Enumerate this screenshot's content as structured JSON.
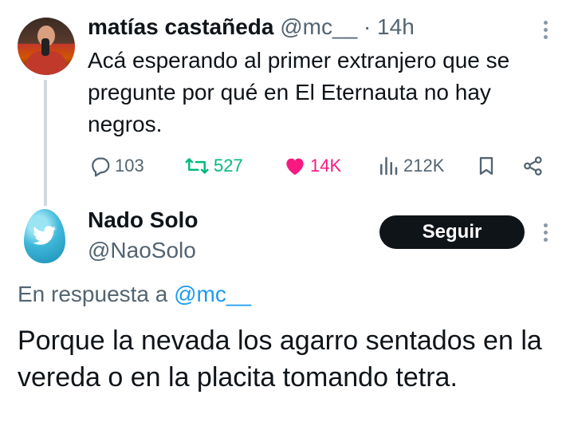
{
  "tweet1": {
    "author_name": "matías castañeda",
    "author_handle": "@mc__",
    "separator": "·",
    "time": "14h",
    "text": "Acá esperando al primer extranjero que se pregunte por qué en El Eternauta no hay negros.",
    "stats": {
      "replies": "103",
      "retweets": "527",
      "likes": "14K",
      "views": "212K"
    },
    "liked": true,
    "colors": {
      "retweet": "#00ba7c",
      "like": "#f91880",
      "muted": "#536471"
    }
  },
  "tweet2": {
    "author_name": "Nado Solo",
    "author_handle": "@NaoSolo",
    "follow_label": "Seguir",
    "reply_prefix": "En respuesta a",
    "reply_to_handle": "@mc__",
    "text": "Porque la nevada los agarro sentados en la vereda o en la placita tomando tetra.",
    "colors": {
      "link": "#1d9bf0",
      "button_bg": "#0f1419"
    }
  }
}
